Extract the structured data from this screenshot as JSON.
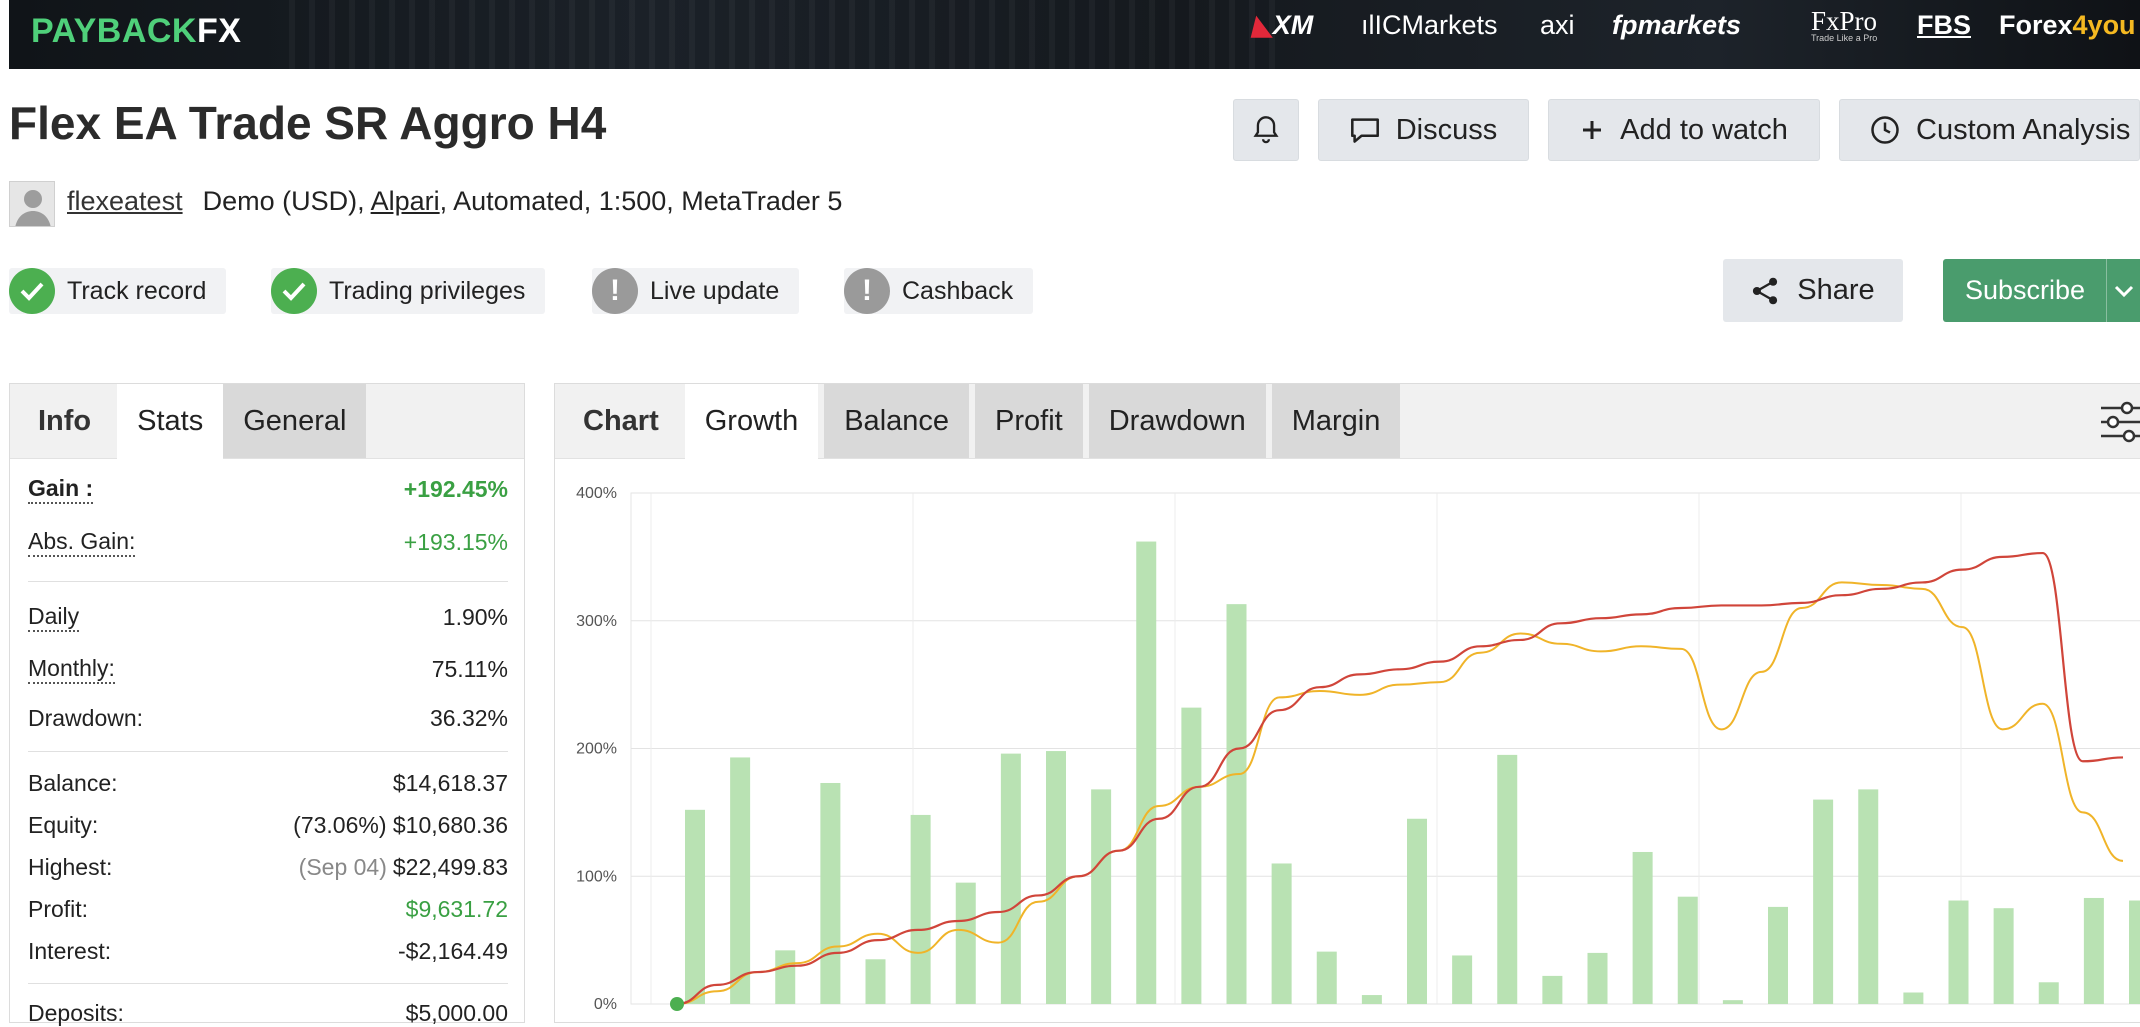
{
  "banner": {
    "brand_main": "PAYBACK",
    "brand_fx": "FX",
    "sponsors": {
      "xm": "XM",
      "icmarkets": "ICMarkets",
      "axi": "axi",
      "fpmarkets": "fpmarkets",
      "fxpro": "FxPro",
      "fxpro_tag": "Trade Like a Pro",
      "fbs": "FBS",
      "forex_a": "Forex",
      "forex_b": "4you"
    }
  },
  "header": {
    "title": "Flex EA Trade SR Aggro H4",
    "discuss": "Discuss",
    "add_to_watch": "Add to watch",
    "custom_analysis": "Custom Analysis"
  },
  "account": {
    "username": "flexeatest",
    "prefix": "Demo (USD), ",
    "broker": "Alpari",
    "suffix": ", Automated, 1:500, MetaTrader 5"
  },
  "badges": [
    {
      "label": "Track record",
      "status": "ok"
    },
    {
      "label": "Trading privileges",
      "status": "ok"
    },
    {
      "label": "Live update",
      "status": "warn"
    },
    {
      "label": "Cashback",
      "status": "warn"
    }
  ],
  "actions": {
    "share": "Share",
    "subscribe": "Subscribe"
  },
  "stats_panel": {
    "tabs": [
      "Info",
      "Stats",
      "General"
    ],
    "gain_label": "Gain :",
    "gain": "+192.45%",
    "abs_gain_label": "Abs. Gain:",
    "abs_gain": "+193.15%",
    "daily_label": "Daily",
    "daily": "1.90%",
    "monthly_label": "Monthly:",
    "monthly": "75.11%",
    "drawdown_label": "Drawdown:",
    "drawdown": "36.32%",
    "balance_label": "Balance:",
    "balance": "$14,618.37",
    "equity_label": "Equity:",
    "equity_pct": "(73.06%)",
    "equity": "$10,680.36",
    "highest_label": "Highest:",
    "highest_date": "(Sep 04)",
    "highest": "$22,499.83",
    "profit_label": "Profit:",
    "profit": "$9,631.72",
    "interest_label": "Interest:",
    "interest": "-$2,164.49",
    "deposits_label": "Deposits:",
    "deposits": "$5,000.00"
  },
  "chart_panel": {
    "tabs": [
      "Chart",
      "Growth",
      "Balance",
      "Profit",
      "Drawdown",
      "Margin"
    ]
  },
  "colors": {
    "green": "#4caf50",
    "subscribe": "#4a9c6d",
    "gain_line": "#d0453a",
    "equity_line": "#f0b429",
    "bars": "#b9e2b3"
  },
  "chart_data": {
    "type": "line",
    "ylim": [
      0,
      400
    ],
    "yticks": [
      "0%",
      "100%",
      "200%",
      "300%",
      "400%"
    ],
    "series": [
      {
        "values": [
          0,
          15,
          25,
          30,
          40,
          50,
          58,
          65,
          72,
          85,
          100,
          120,
          145,
          170,
          200,
          230,
          248,
          258,
          262,
          268,
          280,
          285,
          298,
          302,
          305,
          310,
          312,
          312,
          314,
          320,
          325,
          330,
          340,
          350,
          353,
          190,
          193
        ]
      },
      {
        "values": [
          0,
          10,
          25,
          32,
          45,
          55,
          40,
          58,
          48,
          80,
          100,
          120,
          155,
          170,
          180,
          240,
          245,
          242,
          250,
          252,
          275,
          290,
          282,
          276,
          280,
          278,
          215,
          260,
          310,
          330,
          328,
          325,
          295,
          215,
          235,
          150,
          112
        ]
      }
    ],
    "bars": [
      152,
      193,
      42,
      173,
      35,
      148,
      95,
      196,
      198,
      168,
      362,
      232,
      313,
      110,
      41,
      7,
      145,
      38,
      195,
      22,
      40,
      119,
      84,
      3,
      76,
      160,
      168,
      9,
      81,
      75,
      17,
      83,
      81
    ]
  }
}
